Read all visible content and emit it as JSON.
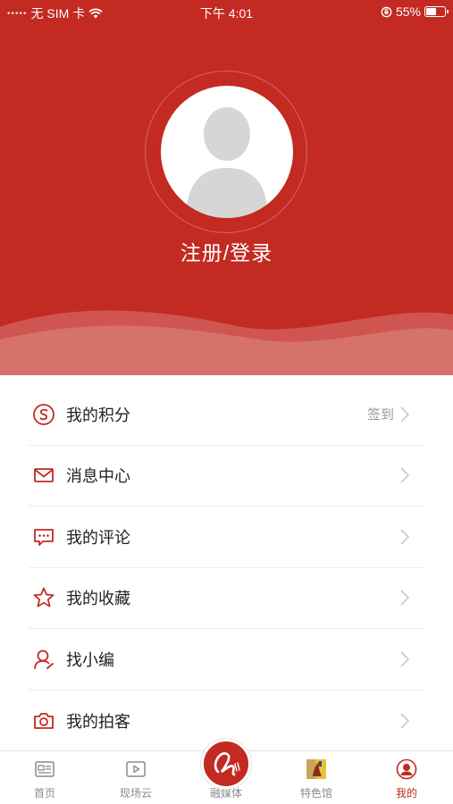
{
  "status_bar": {
    "carrier": "无 SIM 卡",
    "time": "下午 4:01",
    "battery": "55%",
    "battery_level": 0.55
  },
  "header": {
    "login_label": "注册/登录"
  },
  "menu": [
    {
      "label": "我的积分",
      "extra": "签到",
      "icon": "points-icon"
    },
    {
      "label": "消息中心",
      "extra": "",
      "icon": "mail-icon"
    },
    {
      "label": "我的评论",
      "extra": "",
      "icon": "comment-icon"
    },
    {
      "label": "我的收藏",
      "extra": "",
      "icon": "star-icon"
    },
    {
      "label": "找小编",
      "extra": "",
      "icon": "person-icon"
    },
    {
      "label": "我的拍客",
      "extra": "",
      "icon": "camera-icon"
    }
  ],
  "tabs": [
    {
      "label": "首页",
      "icon": "news-icon",
      "active": false
    },
    {
      "label": "现场云",
      "icon": "video-play-icon",
      "active": false
    },
    {
      "label": "融媒体",
      "icon": "media-logo-icon",
      "active": false
    },
    {
      "label": "特色馆",
      "icon": "feature-hall-icon",
      "active": false
    },
    {
      "label": "我的",
      "icon": "user-circle-icon",
      "active": true
    }
  ],
  "colors": {
    "brand_red": "#c22a22",
    "inactive": "#8a8a8a"
  }
}
